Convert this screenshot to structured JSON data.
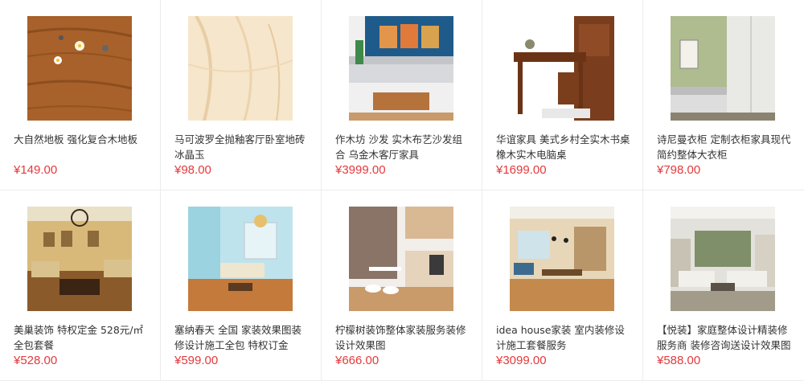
{
  "products": [
    {
      "title": "大自然地板 强化复合木地板",
      "price": "¥149.00"
    },
    {
      "title": "马可波罗全抛釉客厅卧室地砖冰晶玉",
      "price": "¥98.00"
    },
    {
      "title": "作木坊 沙发 实木布艺沙发组合 乌金木客厅家具",
      "price": "¥3999.00"
    },
    {
      "title": "华谊家具 美式乡村全实木书桌 橡木实木电脑桌",
      "price": "¥1699.00"
    },
    {
      "title": "诗尼曼衣柜 定制衣柜家具现代简约整体大衣柜",
      "price": "¥798.00"
    },
    {
      "title": "美巢装饰 特权定金 528元/㎡全包套餐",
      "price": "¥528.00"
    },
    {
      "title": "塞纳春天 全国 家装效果图装修设计施工全包 特权订金",
      "price": "¥599.00"
    },
    {
      "title": "柠檬树装饰整体家装服务装修设计效果图",
      "price": "¥666.00"
    },
    {
      "title": "idea house家装 室内装修设计施工套餐服务",
      "price": "¥3099.00"
    },
    {
      "title": "【悦装】家庭整体设计精装修服务商 装修咨询送设计效果图",
      "price": "¥588.00"
    }
  ],
  "colors": {
    "price": "#e4393c",
    "text": "#333333",
    "divider": "#ececec"
  }
}
